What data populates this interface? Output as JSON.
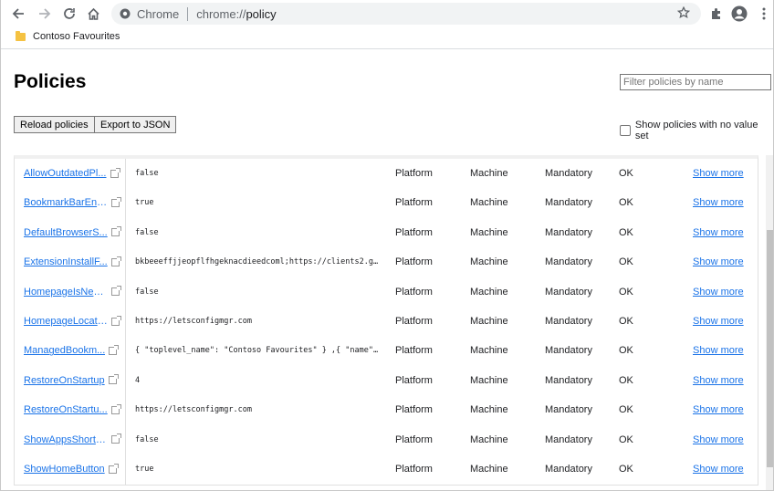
{
  "toolbar": {
    "omnibox_chrome_label": "Chrome",
    "omnibox_scheme": "chrome://",
    "omnibox_path": "policy"
  },
  "bookmarks": [
    {
      "label": "Contoso Favourites"
    }
  ],
  "page": {
    "title": "Policies",
    "filter_placeholder": "Filter policies by name",
    "reload_label": "Reload policies",
    "export_label": "Export to JSON",
    "show_no_value_label": "Show policies with no value set"
  },
  "policies": [
    {
      "name": "AllowOutdatedPl...",
      "value": "false",
      "source": "Platform",
      "scope": "Machine",
      "level": "Mandatory",
      "status": "OK",
      "more": "Show more"
    },
    {
      "name": "BookmarkBarEna...",
      "value": "true",
      "source": "Platform",
      "scope": "Machine",
      "level": "Mandatory",
      "status": "OK",
      "more": "Show more"
    },
    {
      "name": "DefaultBrowserS...",
      "value": "false",
      "source": "Platform",
      "scope": "Machine",
      "level": "Mandatory",
      "status": "OK",
      "more": "Show more"
    },
    {
      "name": "ExtensionInstallF...",
      "value": "bkbeeeffjjeopflfhgeknacdieedcoml;https://clients2.goog...",
      "source": "Platform",
      "scope": "Machine",
      "level": "Mandatory",
      "status": "OK",
      "more": "Show more"
    },
    {
      "name": "HomepageIsNew...",
      "value": "false",
      "source": "Platform",
      "scope": "Machine",
      "level": "Mandatory",
      "status": "OK",
      "more": "Show more"
    },
    {
      "name": "HomepageLocati...",
      "value": "https://letsconfigmgr.com",
      "source": "Platform",
      "scope": "Machine",
      "level": "Mandatory",
      "status": "OK",
      "more": "Show more"
    },
    {
      "name": "ManagedBookm...",
      "value": "{ \"toplevel_name\": \"Contoso Favourites\" } ,{ \"name\": \"...",
      "source": "Platform",
      "scope": "Machine",
      "level": "Mandatory",
      "status": "OK",
      "more": "Show more"
    },
    {
      "name": "RestoreOnStartup",
      "value": "4",
      "source": "Platform",
      "scope": "Machine",
      "level": "Mandatory",
      "status": "OK",
      "more": "Show more"
    },
    {
      "name": "RestoreOnStartu...",
      "value": "https://letsconfigmgr.com",
      "source": "Platform",
      "scope": "Machine",
      "level": "Mandatory",
      "status": "OK",
      "more": "Show more"
    },
    {
      "name": "ShowAppsShortc...",
      "value": "false",
      "source": "Platform",
      "scope": "Machine",
      "level": "Mandatory",
      "status": "OK",
      "more": "Show more"
    },
    {
      "name": "ShowHomeButton",
      "value": "true",
      "source": "Platform",
      "scope": "Machine",
      "level": "Mandatory",
      "status": "OK",
      "more": "Show more"
    }
  ]
}
